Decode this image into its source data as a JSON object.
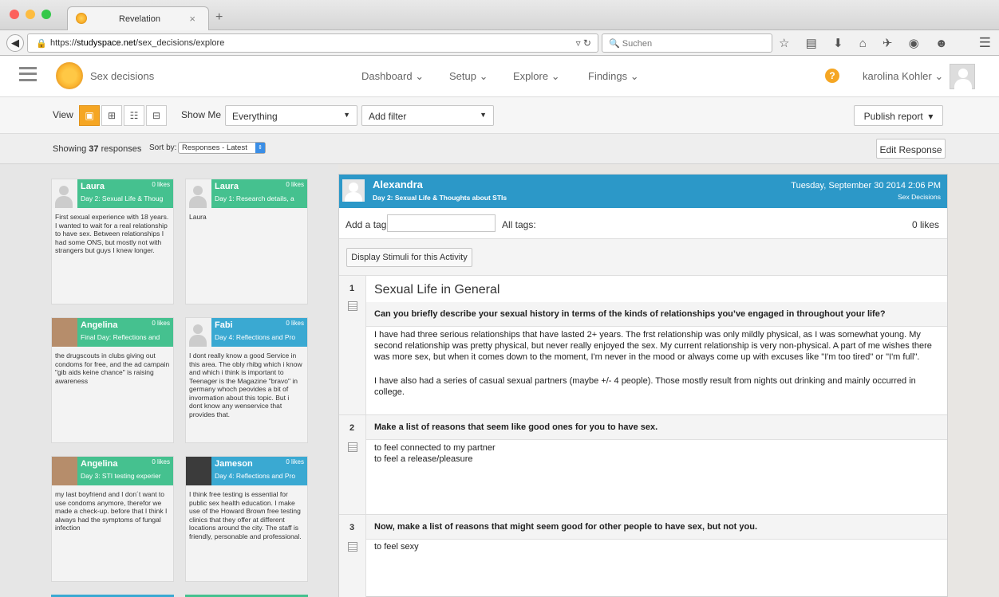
{
  "browser": {
    "tab_title": "Revelation",
    "url_scheme": "https://",
    "url_host": "studyspace.net",
    "url_path": "/sex_decisions/explore",
    "search_placeholder": "Suchen"
  },
  "app": {
    "project": "Sex decisions",
    "menu": [
      "Dashboard",
      "Setup",
      "Explore",
      "Findings"
    ],
    "user": "karolina Kohler"
  },
  "toolbar": {
    "view_label": "View",
    "show_me_label": "Show Me",
    "show_me_value": "Everything",
    "filter_value": "Add filter",
    "publish": "Publish report"
  },
  "sortbar": {
    "showing_prefix": "Showing",
    "count": "37",
    "showing_suffix": "responses",
    "sort_label": "Sort by:",
    "sort_value": "Responses - Latest",
    "edit": "Edit Response"
  },
  "cards": [
    {
      "name": "Laura",
      "likes": "0 likes",
      "day": "Day 2: Sexual Life & Thoug",
      "body": "First sexual experience with 18 years. I wanted to wait for a real relationship to have sex. Between relationships I had some ONS, but mostly not with strangers but guys I knew longer.",
      "color": "#45c18f"
    },
    {
      "name": "Laura",
      "likes": "0 likes",
      "day": "Day 1: Research details, a",
      "body": "Laura",
      "color": "#45c18f"
    },
    {
      "name": "Angelina",
      "likes": "0 likes",
      "day": "Final Day: Reflections and",
      "body": "the drugscouts in clubs giving out condoms for free, and the ad campain \"gib aids keine chance\" is raising awareness",
      "color": "#45c18f"
    },
    {
      "name": "Fabi",
      "likes": "0 likes",
      "day": "Day 4: Reflections and Pro",
      "body": "I dont really know a good Service in this area. The obly rhibg which i know and which i think is important to Teenager is the Magazine \"bravo\" in germany whoch peovides a bit of invormation about this topic. But i dont know any wenservice that provides that.",
      "color": "#3aa9d2"
    },
    {
      "name": "Angelina",
      "likes": "0 likes",
      "day": "Day 3: STI testing experier",
      "body": "my last boyfriend and I don´t want to use condoms anymore, therefor we made a check-up. before that I think I always had the symptoms of fungal infection",
      "color": "#45c18f"
    },
    {
      "name": "Jameson",
      "likes": "0 likes",
      "day": "Day 4: Reflections and Pro",
      "body": "I think free testing is essential for public sex health education. I make use of the Howard Brown free testing clinics that they offer at different locations around the city. The staff is friendly, personable and professional.",
      "color": "#3aa9d2"
    }
  ],
  "detail": {
    "name": "Alexandra",
    "day": "Day 2: Sexual Life & Thoughts about STIs",
    "timestamp": "Tuesday, September 30 2014 2:06 PM",
    "source": "Sex Decisions",
    "add_tag_label": "Add a tag:",
    "all_tags_label": "All tags:",
    "likes": "0 likes",
    "stimuli_button": "Display Stimuli for this Activity",
    "section_title": "Sexual Life in General",
    "questions": [
      {
        "num": "1",
        "text": "Can you briefly describe your sexual history in terms of the kinds of relationships you’ve engaged in throughout your life?",
        "answer_p1": "I have had three serious relationships that have lasted 2+ years. The frst relationship was only mildly physical, as I was somewhat young. My second relationship was pretty physical, but never really enjoyed the sex. My current relationship is very non-physical. A part of me wishes there was more sex, but when it comes down to the moment, I'm never in the mood or always come up with excuses like \"I'm too tired\" or \"I'm full\".",
        "answer_p2": "I have also had a series of casual sexual partners (maybe +/- 4 people). Those mostly result from nights out drinking and mainly occurred in college."
      },
      {
        "num": "2",
        "text": "Make a list of reasons that seem like good ones for you to have sex.",
        "answer_l1": "to feel connected to my partner",
        "answer_l2": "to feel a release/pleasure"
      },
      {
        "num": "3",
        "text": "Now, make a list of reasons that might seem good for other people to have sex, but not you.",
        "answer_l1": "to feel sexy"
      }
    ]
  }
}
